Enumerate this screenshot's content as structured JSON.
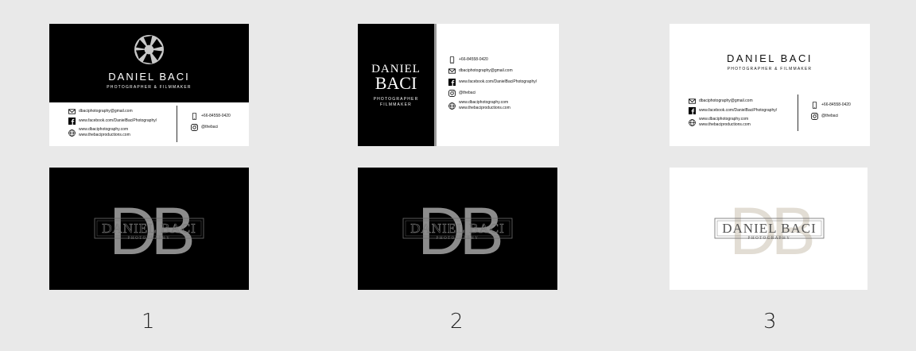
{
  "name": "DANIEL BACI",
  "name_first": "DANIEL",
  "name_last": "BACI",
  "tagline": "PHOTOGRAPHER & FILMMAKER",
  "role1": "PHOTOGRAPHER",
  "role2": "FILMMAKER",
  "email": "dbaciphotography@gmail.com",
  "facebook": "www.facebook.com/DanielBaciPhotography/",
  "web1": "www.dbaciphotography.com",
  "web2": "www.thebaciproductions.com",
  "phone": "+66-84558-0420",
  "instagram": "@thebaci",
  "logo": {
    "monogram": "DB",
    "wordmark": "DANIEL BACI",
    "subword": "PHOTOGRAPHY"
  },
  "labels": [
    "1",
    "2",
    "3"
  ],
  "colors": {
    "background": "#e9e9e9",
    "black": "#000000",
    "monogram_dark": "#8c8c8c",
    "monogram_light": "#e2ddd4"
  }
}
